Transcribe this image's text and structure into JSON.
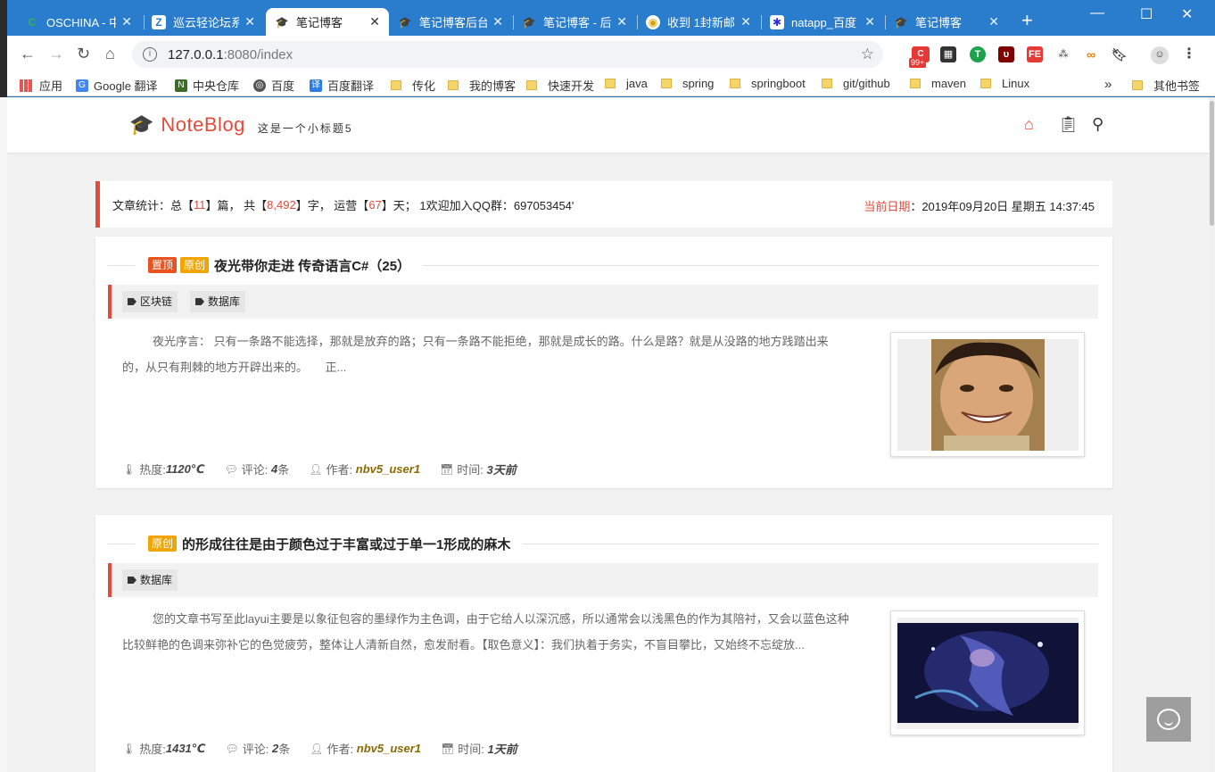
{
  "browser": {
    "tabs": [
      {
        "title": "OSCHINA - 中",
        "icon": "oschina-icon",
        "color": "#37b24d"
      },
      {
        "title": "巡云轻论坛系",
        "icon": "forum-icon",
        "color": "#4a90e2"
      },
      {
        "title": "笔记博客",
        "icon": "mortarboard-icon",
        "color": "#222",
        "active": true
      },
      {
        "title": "笔记博客后台",
        "icon": "mortarboard-icon",
        "color": "#222"
      },
      {
        "title": "笔记博客 - 后",
        "icon": "mortarboard-icon",
        "color": "#222"
      },
      {
        "title": "收到 1封新邮",
        "icon": "mail-icon",
        "color": "#e0a000"
      },
      {
        "title": "natapp_百度",
        "icon": "baidu-icon",
        "color": "#2932e1"
      },
      {
        "title": "笔记博客",
        "icon": "mortarboard-icon",
        "color": "#222"
      }
    ],
    "new_tab": "+",
    "url_host": "127.0.0.1",
    "url_rest": ":8080/index",
    "ext_badge": "99+",
    "bookmarks": [
      {
        "label": "应用",
        "kind": "apps"
      },
      {
        "label": "Google 翻译",
        "kind": "icon",
        "color": "#4285f4",
        "glyph": "G"
      },
      {
        "label": "中央仓库",
        "kind": "icon",
        "color": "#3d6b2a",
        "glyph": "N"
      },
      {
        "label": "百度",
        "kind": "icon",
        "color": "#555",
        "glyph": "◎"
      },
      {
        "label": "百度翻译",
        "kind": "icon",
        "color": "#2d7be5",
        "glyph": "译"
      },
      {
        "label": "传化",
        "kind": "folder"
      },
      {
        "label": "我的博客",
        "kind": "folder"
      },
      {
        "label": "快速开发",
        "kind": "folder"
      },
      {
        "label": "java",
        "kind": "folder"
      },
      {
        "label": "spring",
        "kind": "folder"
      },
      {
        "label": "springboot",
        "kind": "folder"
      },
      {
        "label": "git/github",
        "kind": "folder"
      },
      {
        "label": "maven",
        "kind": "folder"
      },
      {
        "label": "Linux",
        "kind": "folder"
      }
    ],
    "more_bookmarks": "»",
    "other_bookmarks": "其他书签"
  },
  "site": {
    "brand": "NoteBlog",
    "subtitle": "这是一个小标题5",
    "accent": "#e64a3b"
  },
  "stats": {
    "p1": "文章统计：总【",
    "articles": "11",
    "p2": "】篇， 共【",
    "words": "8,492",
    "p3": "】字， 运营【",
    "days": "67",
    "p4": "】天； 1欢迎加入QQ群：697053454'",
    "date_label": "当前日期",
    "date_value": "：2019年09月20日 星期五 14:37:45"
  },
  "posts": [
    {
      "top_badge": "置顶",
      "orig_badge": "原创",
      "title": "夜光带你走进 传奇语言C#（25）",
      "tags": [
        "区块链",
        "数据库"
      ],
      "excerpt": "夜光序言： 只有一条路不能选择，那就是放弃的路；只有一条路不能拒绝，那就是成长的路。什么是路？就是从没路的地方践踏出来的，从只有荆棘的地方开辟出来的。　　正...",
      "heat_label": "热度:",
      "heat": "1120℃",
      "comment_label": "评论:",
      "comments": "4",
      "comment_unit": "条",
      "author_label": "作者:",
      "author": "nbv5_user1",
      "time_label": "时间:",
      "time": "3天前"
    },
    {
      "orig_badge": "原创",
      "title": "的形成往往是由于颜色过于丰富或过于单一1形成的麻木",
      "tags": [
        "数据库"
      ],
      "excerpt": "您的文章书写至此layui主要是以象征包容的墨绿作为主色调，由于它给人以深沉感，所以通常会以浅黑色的作为其陪衬，又会以蓝色这种比较鲜艳的色调来弥补它的色觉疲劳，整体让人清新自然，愈发耐看。【取色意义】：我们执着于务实，不盲目攀比，又始终不忘绽放...",
      "heat_label": "热度:",
      "heat": "1431℃",
      "comment_label": "评论:",
      "comments": "2",
      "comment_unit": "条",
      "author_label": "作者:",
      "author": "nbv5_user1",
      "time_label": "时间:",
      "time": "1天前"
    }
  ]
}
